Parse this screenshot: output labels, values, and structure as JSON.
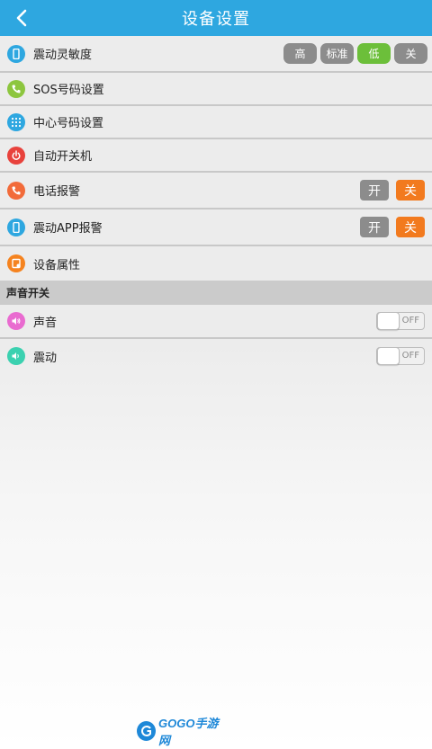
{
  "header": {
    "title": "设备设置",
    "back_icon": "chevron-left-icon"
  },
  "colors": {
    "header_bg": "#2ea7e0",
    "active_green": "#6cbf3a",
    "active_orange": "#f27a1e",
    "inactive_gray": "#8c8c8c"
  },
  "settings": {
    "vibration_sensitivity": {
      "label": "震动灵敏度",
      "options": [
        "高",
        "标准",
        "低",
        "关"
      ],
      "selected": "低"
    },
    "sos_numbers": {
      "label": "SOS号码设置"
    },
    "center_number": {
      "label": "中心号码设置"
    },
    "auto_power": {
      "label": "自动开关机"
    },
    "phone_alarm": {
      "label": "电话报警",
      "on_label": "开",
      "off_label": "关",
      "selected": "关"
    },
    "vibration_app_alarm": {
      "label": "震动APP报警",
      "on_label": "开",
      "off_label": "关",
      "selected": "关"
    },
    "device_properties": {
      "label": "设备属性"
    }
  },
  "sound_section": {
    "title": "声音开关",
    "sound": {
      "label": "声音",
      "state": "OFF"
    },
    "vibration": {
      "label": "震动",
      "state": "OFF"
    }
  },
  "watermark": {
    "text": "GOGO手游网"
  }
}
